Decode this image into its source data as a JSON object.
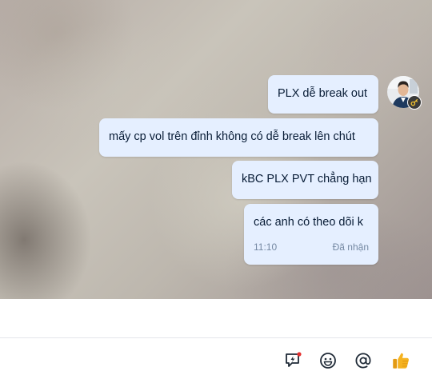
{
  "messages": [
    {
      "text": "PLX dễ break out"
    },
    {
      "text": "mấy cp vol trên đỉnh không có dễ break lên chút"
    },
    {
      "text": "kBC PLX PVT chẳng hạn"
    },
    {
      "text": "các anh có theo dõi k",
      "time": "11:10",
      "status": "Đã nhận"
    }
  ],
  "composer": {
    "value": "",
    "placeholder": ""
  },
  "toolbar": {
    "icons": [
      "quick-message-icon",
      "emoji-icon",
      "mention-icon",
      "thumbs-up-icon"
    ],
    "quick_message_dot_color": "#e5302f"
  },
  "colors": {
    "bubble_bg": "#e5efff",
    "text": "#081c36",
    "meta": "#7589a3",
    "icon": "#1f2a37",
    "like": "#f5b321"
  }
}
